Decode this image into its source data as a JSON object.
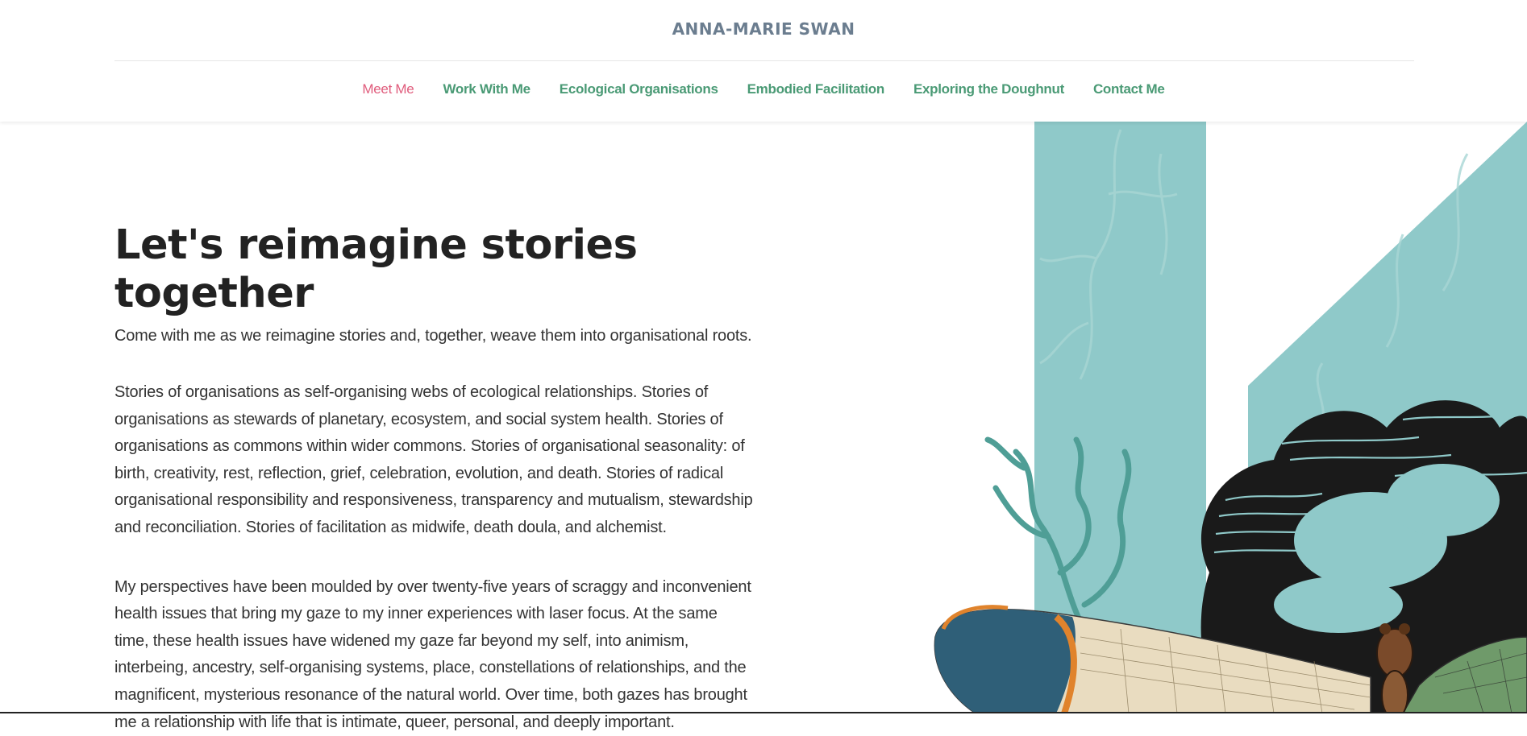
{
  "header": {
    "site_title": "ANNA-MARIE SWAN",
    "nav": [
      {
        "label": "Meet Me",
        "active": true
      },
      {
        "label": "Work With Me"
      },
      {
        "label": "Ecological Organisations"
      },
      {
        "label": "Embodied Facilitation"
      },
      {
        "label": "Exploring the Doughnut"
      },
      {
        "label": "Contact Me"
      }
    ]
  },
  "hero": {
    "headline": "Let's reimagine stories together",
    "lead": "Come with me as we reimagine stories and, together, weave them into organisational roots.",
    "paragraphs": [
      "Stories of organisations as self-organising webs of ecological relationships. Stories of organisations as stewards of planetary, ecosystem, and social system health. Stories of organisations as commons within wider commons. Stories of organisational seasonality: of birth, creativity, rest, reflection, grief, celebration, evolution, and death. Stories of radical organisational responsibility and responsiveness, transparency and mutualism, stewardship and reconciliation. Stories of facilitation as midwife, death doula, and alchemist.",
      "My perspectives have been moulded by over twenty-five years of scraggy and inconvenient health issues that bring my gaze to my inner experiences with laser focus. At the same time, these health issues have widened my gaze far beyond my self, into animism, interbeing, ancestry, self-organising systems, place, constellations of relationships, and the magnificent, mysterious resonance of the natural world. Over time, both gazes has brought me a relationship with life that is intimate, queer, personal, and deeply important."
    ]
  },
  "colors": {
    "nav_link": "#4a9a75",
    "nav_active": "#e05c7c",
    "site_title": "#6b7d8f",
    "teal": "#8fc9c9",
    "teal_dark": "#4f9e96"
  },
  "art": {
    "icons": [
      "lichen-branch-icon",
      "dragonfly-illustration",
      "black-cloud-engraving"
    ]
  }
}
